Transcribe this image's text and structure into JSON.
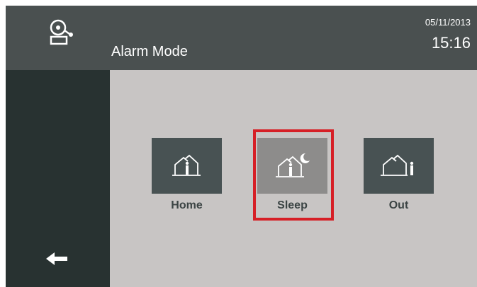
{
  "header": {
    "icon": "alarm-bell-icon",
    "title": "Alarm Mode",
    "date": "05/11/2013",
    "time": "15:16"
  },
  "sidebar": {
    "back_icon": "arrow-left-icon"
  },
  "modes": [
    {
      "label": "Home",
      "icon": "house-person-inside-icon",
      "selected": false
    },
    {
      "label": "Sleep",
      "icon": "house-person-moon-icon",
      "selected": true
    },
    {
      "label": "Out",
      "icon": "house-person-outside-icon",
      "selected": false
    }
  ],
  "colors": {
    "header_bg": "#4a5050",
    "sidebar_bg": "#283231",
    "content_bg": "#c8c5c4",
    "tile_bg": "#485253",
    "tile_selected_bg": "#8d8c8b",
    "selection_border": "#d61f26"
  }
}
